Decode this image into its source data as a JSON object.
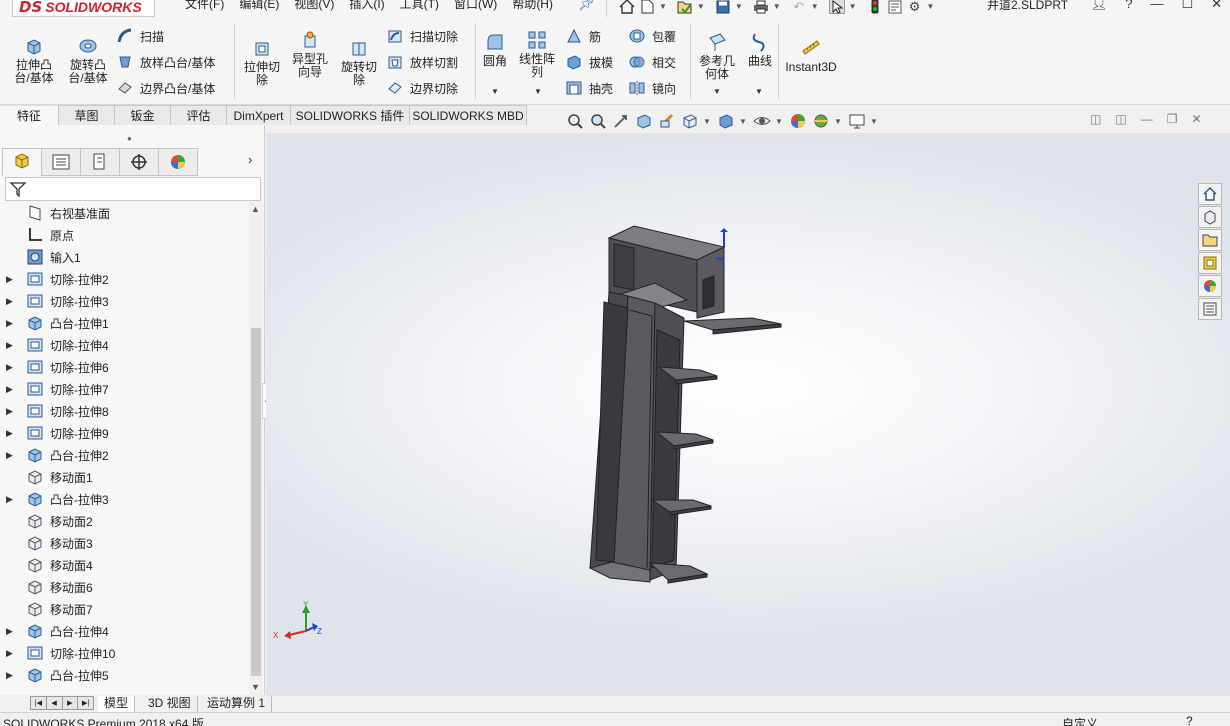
{
  "app": {
    "logo_prefix": "DS",
    "logo_text": "SOLIDWORKS",
    "document_title": "井道2.SLDPRT"
  },
  "menu": [
    "文件(F)",
    "编辑(E)",
    "视图(V)",
    "插入(I)",
    "工具(T)",
    "窗口(W)",
    "帮助(H)"
  ],
  "ribbon": {
    "extrude_boss": [
      "拉伸凸",
      "台/基体"
    ],
    "revolve_boss": [
      "旋转凸",
      "台/基体"
    ],
    "sweep": "扫描",
    "loft_boss": "放样凸台/基体",
    "boundary_boss": "边界凸台/基体",
    "extrude_cut": [
      "拉伸切",
      "除"
    ],
    "hole_wizard": [
      "异型孔",
      "向导"
    ],
    "revolve_cut": [
      "旋转切",
      "除"
    ],
    "sweep_cut": "扫描切除",
    "loft_cut": "放样切割",
    "boundary_cut": "边界切除",
    "fillet": "圆角",
    "linear_pattern": [
      "线性阵",
      "列"
    ],
    "rib": "筋",
    "draft": "拔模",
    "shell": "抽壳",
    "wrap": "包覆",
    "intersect": "相交",
    "mirror": "镜向",
    "ref_geometry": [
      "参考几",
      "何体"
    ],
    "curves": "曲线",
    "instant3d": "Instant3D"
  },
  "tabs": [
    "特征",
    "草图",
    "钣金",
    "评估",
    "DimXpert",
    "SOLIDWORKS 插件",
    "SOLIDWORKS MBD"
  ],
  "tree": [
    {
      "label": "右视基准面",
      "icon": "plane",
      "expandable": false
    },
    {
      "label": "原点",
      "icon": "origin",
      "expandable": false
    },
    {
      "label": "输入1",
      "icon": "import",
      "expandable": false
    },
    {
      "label": "切除-拉伸2",
      "icon": "cut",
      "expandable": true
    },
    {
      "label": "切除-拉伸3",
      "icon": "cut",
      "expandable": true
    },
    {
      "label": "凸台-拉伸1",
      "icon": "boss",
      "expandable": true
    },
    {
      "label": "切除-拉伸4",
      "icon": "cut",
      "expandable": true
    },
    {
      "label": "切除-拉伸6",
      "icon": "cut",
      "expandable": true
    },
    {
      "label": "切除-拉伸7",
      "icon": "cut",
      "expandable": true
    },
    {
      "label": "切除-拉伸8",
      "icon": "cut",
      "expandable": true
    },
    {
      "label": "切除-拉伸9",
      "icon": "cut",
      "expandable": true
    },
    {
      "label": "凸台-拉伸2",
      "icon": "boss",
      "expandable": true
    },
    {
      "label": "移动面1",
      "icon": "move",
      "expandable": false
    },
    {
      "label": "凸台-拉伸3",
      "icon": "boss",
      "expandable": true
    },
    {
      "label": "移动面2",
      "icon": "move",
      "expandable": false
    },
    {
      "label": "移动面3",
      "icon": "move",
      "expandable": false
    },
    {
      "label": "移动面4",
      "icon": "move",
      "expandable": false
    },
    {
      "label": "移动面6",
      "icon": "move",
      "expandable": false
    },
    {
      "label": "移动面7",
      "icon": "move",
      "expandable": false
    },
    {
      "label": "凸台-拉伸4",
      "icon": "boss",
      "expandable": true
    },
    {
      "label": "切除-拉伸10",
      "icon": "cut",
      "expandable": true
    },
    {
      "label": "凸台-拉伸5",
      "icon": "boss",
      "expandable": true
    }
  ],
  "bottom_tabs": [
    "模型",
    "3D 视图",
    "运动算例 1"
  ],
  "status": {
    "left": "SOLIDWORKS Premium 2018 x64 版",
    "right": "自定义"
  },
  "triad": {
    "x": "X",
    "y": "Y",
    "z": "Z"
  },
  "colors": {
    "accent": "#2d6fc6",
    "brand": "#d2222d",
    "model": "#5d5c63"
  }
}
